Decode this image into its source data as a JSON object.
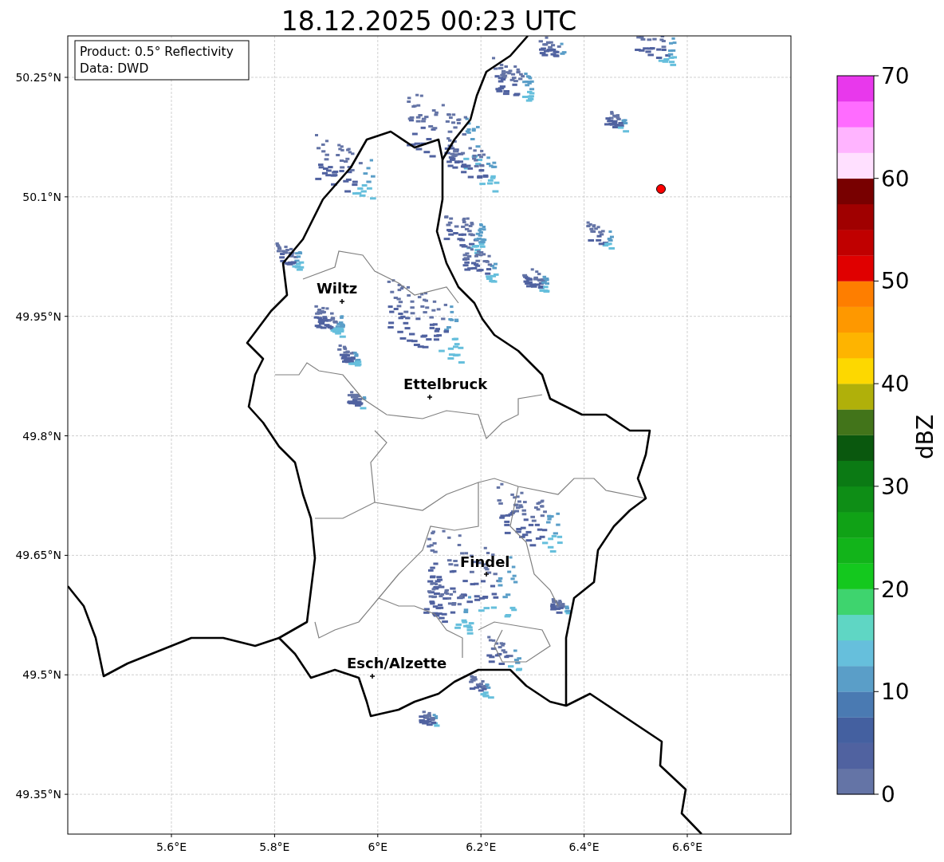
{
  "title": "18.12.2025 00:23 UTC",
  "info_box": [
    "Product: 0.5° Reflectivity",
    "Data: DWD"
  ],
  "map": {
    "xticks": [
      "5.6°E",
      "5.8°E",
      "6°E",
      "6.2°E",
      "6.4°E",
      "6.6°E"
    ],
    "yticks": [
      "50.25°N",
      "50.1°N",
      "49.95°N",
      "49.8°N",
      "49.65°N",
      "49.5°N",
      "49.35°N"
    ],
    "cities": [
      {
        "name": "Wiltz",
        "kind": "city"
      },
      {
        "name": "Ettelbruck",
        "kind": "city"
      },
      {
        "name": "Findel",
        "kind": "city"
      },
      {
        "name": "Esch/Alzette",
        "kind": "city"
      }
    ],
    "radar_site": {
      "color": "#ff0000"
    }
  },
  "colorbar": {
    "label": "dBZ",
    "ticks": [
      "70",
      "60",
      "50",
      "40",
      "30",
      "20",
      "10",
      "0"
    ],
    "segments": [
      {
        "color": "#6474a6"
      },
      {
        "color": "#5062a0"
      },
      {
        "color": "#4460a0"
      },
      {
        "color": "#4a7ab2"
      },
      {
        "color": "#5a9ec8"
      },
      {
        "color": "#66bfdc"
      },
      {
        "color": "#5fd6c4"
      },
      {
        "color": "#3ed46e"
      },
      {
        "color": "#14c81e"
      },
      {
        "color": "#12b41a"
      },
      {
        "color": "#10a216"
      },
      {
        "color": "#0e8e16"
      },
      {
        "color": "#0b7a14"
      },
      {
        "color": "#0a580e"
      },
      {
        "color": "#42741a"
      },
      {
        "color": "#b0b00a"
      },
      {
        "color": "#fdd800"
      },
      {
        "color": "#feb400"
      },
      {
        "color": "#fe9800"
      },
      {
        "color": "#fe7e00"
      },
      {
        "color": "#e00000"
      },
      {
        "color": "#c00000"
      },
      {
        "color": "#a00000"
      },
      {
        "color": "#780000"
      },
      {
        "color": "#ffe0ff"
      },
      {
        "color": "#ffb4ff"
      },
      {
        "color": "#ff6cff"
      },
      {
        "color": "#e838ec"
      }
    ]
  }
}
